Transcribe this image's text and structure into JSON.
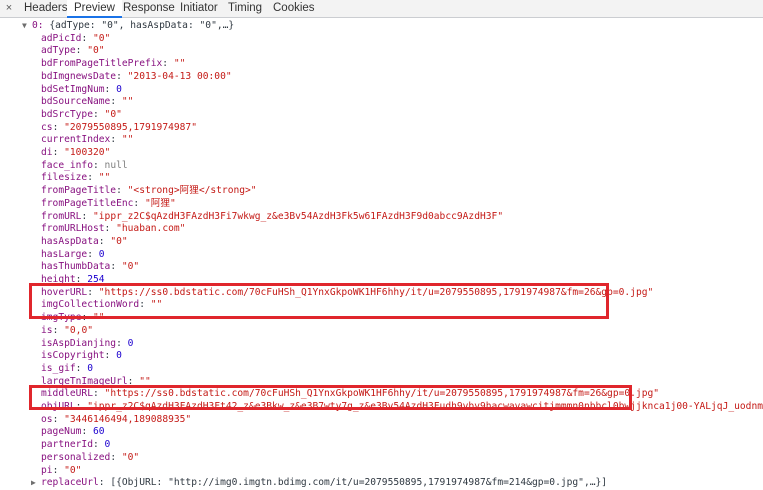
{
  "tabs": [
    {
      "label": "Headers",
      "active": false
    },
    {
      "label": "Preview",
      "active": true
    },
    {
      "label": "Response",
      "active": false
    },
    {
      "label": "Initiator",
      "active": false
    },
    {
      "label": "Timing",
      "active": false
    },
    {
      "label": "Cookies",
      "active": false
    }
  ],
  "close_symbol": "×",
  "root_line": {
    "arrow": "▼",
    "index": "0:",
    "preview": " {adType: \"0\", hasAspData: \"0\",…}"
  },
  "properties": [
    {
      "key": "adPicId",
      "value": "\"0\"",
      "type": "str"
    },
    {
      "key": "adType",
      "value": "\"0\"",
      "type": "str"
    },
    {
      "key": "bdFromPageTitlePrefix",
      "value": "\"\"",
      "type": "str"
    },
    {
      "key": "bdImgnewsDate",
      "value": "\"2013-04-13 00:00\"",
      "type": "str"
    },
    {
      "key": "bdSetImgNum",
      "value": "0",
      "type": "num"
    },
    {
      "key": "bdSourceName",
      "value": "\"\"",
      "type": "str"
    },
    {
      "key": "bdSrcType",
      "value": "\"0\"",
      "type": "str"
    },
    {
      "key": "cs",
      "value": "\"2079550895,1791974987\"",
      "type": "str"
    },
    {
      "key": "currentIndex",
      "value": "\"\"",
      "type": "str"
    },
    {
      "key": "di",
      "value": "\"100320\"",
      "type": "str"
    },
    {
      "key": "face_info",
      "value": "null",
      "type": "nul"
    },
    {
      "key": "filesize",
      "value": "\"\"",
      "type": "str"
    },
    {
      "key": "fromPageTitle",
      "value": "\"<strong>阿狸</strong>\"",
      "type": "str"
    },
    {
      "key": "fromPageTitleEnc",
      "value": "\"阿狸\"",
      "type": "str"
    },
    {
      "key": "fromURL",
      "value": "\"ippr_z2C$qAzdH3FAzdH3Fi7wkwg_z&e3Bv54AzdH3Fk5w61FAzdH3F9d0abcc9AzdH3F\"",
      "type": "str"
    },
    {
      "key": "fromURLHost",
      "value": "\"huaban.com\"",
      "type": "str"
    },
    {
      "key": "hasAspData",
      "value": "\"0\"",
      "type": "str"
    },
    {
      "key": "hasLarge",
      "value": "0",
      "type": "num"
    },
    {
      "key": "hasThumbData",
      "value": "\"0\"",
      "type": "str"
    },
    {
      "key": "height",
      "value": "254",
      "type": "num"
    },
    {
      "key": "hoverURL",
      "value": "\"https://ss0.bdstatic.com/70cFuHSh_Q1YnxGkpoWK1HF6hhy/it/u=2079550895,1791974987&fm=26&gp=0.jpg\"",
      "type": "str"
    },
    {
      "key": "imgCollectionWord",
      "value": "\"\"",
      "type": "str"
    },
    {
      "key": "imgType",
      "value": "\"\"",
      "type": "str"
    },
    {
      "key": "is",
      "value": "\"0,0\"",
      "type": "str"
    },
    {
      "key": "isAspDianjing",
      "value": "0",
      "type": "num"
    },
    {
      "key": "isCopyright",
      "value": "0",
      "type": "num"
    },
    {
      "key": "is_gif",
      "value": "0",
      "type": "num"
    },
    {
      "key": "largeTnImageUrl",
      "value": "\"\"",
      "type": "str"
    },
    {
      "key": "middleURL",
      "value": "\"https://ss0.bdstatic.com/70cFuHSh_Q1YnxGkpoWK1HF6hhy/it/u=2079550895,1791974987&fm=26&gp=0.jpg\"",
      "type": "str"
    },
    {
      "key": "objURL",
      "value": "\"ippr_z2C$qAzdH3FAzdH3Ft42_z&e3Bkw_z&e3B7wty7g_z&e3Bv54AzdH3Fudh9vbv9hacwavawcitjmmmn0nbbcl0bwjjknca1j00-YALjqJ_uodnm\"",
      "type": "str"
    },
    {
      "key": "os",
      "value": "\"3446146494,189088935\"",
      "type": "str"
    },
    {
      "key": "pageNum",
      "value": "60",
      "type": "num"
    },
    {
      "key": "partnerId",
      "value": "0",
      "type": "num"
    },
    {
      "key": "personalized",
      "value": "\"0\"",
      "type": "str"
    },
    {
      "key": "pi",
      "value": "\"0\"",
      "type": "str"
    }
  ],
  "last_line": {
    "arrow": "▶",
    "key": "replaceUrl",
    "preview": "[{ObjURL: \"http://img0.imgtn.bdimg.com/it/u=2079550895,1791974987&fm=214&gp=0.jpg\",…}]"
  },
  "highlight_color": "#e0262c"
}
